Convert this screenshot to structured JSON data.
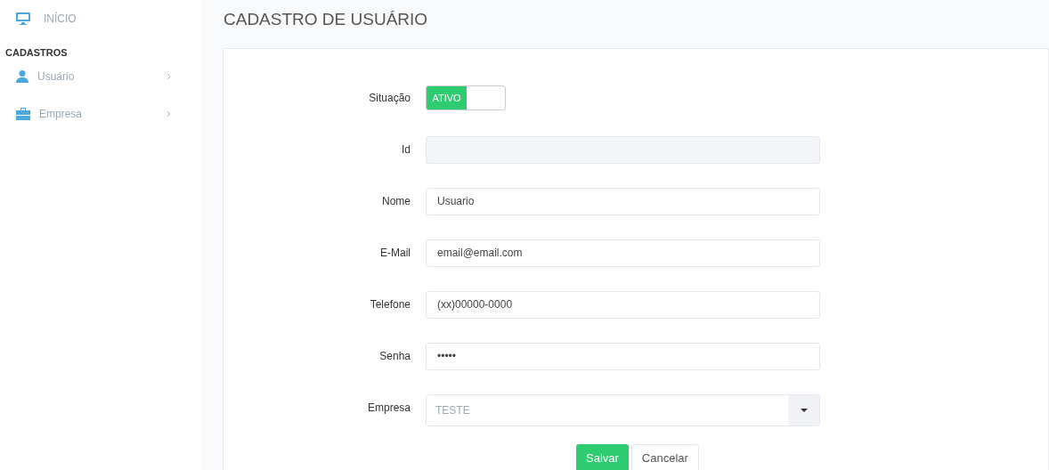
{
  "sidebar": {
    "home": {
      "label": "INÍCIO"
    },
    "section": "CADASTROS",
    "items": [
      {
        "label": "Usuário"
      },
      {
        "label": "Empresa"
      }
    ]
  },
  "page_title": "CADASTRO DE USUÁRIO",
  "form": {
    "fields": [
      {
        "kind": "toggle",
        "label": "Situação",
        "on": true,
        "text": "ATIVO"
      },
      {
        "kind": "text",
        "label": "Id",
        "disabled": true
      },
      {
        "kind": "text",
        "label": "Nome",
        "value": "Usuario",
        "disabled": false
      },
      {
        "kind": "text",
        "label": "E-Mail",
        "value": "email@email.com",
        "disabled": false
      },
      {
        "kind": "text",
        "label": "Telefone",
        "value": "(xx)00000-0000",
        "disabled": false
      },
      {
        "kind": "text",
        "label": "Senha",
        "value": "•••••",
        "disabled": false
      },
      {
        "kind": "select",
        "label": "Empresa",
        "value": "TESTE"
      }
    ],
    "buttons": [
      {
        "label": "Salvar",
        "kind": "primary"
      },
      {
        "label": "Cancelar",
        "kind": "default"
      }
    ]
  }
}
